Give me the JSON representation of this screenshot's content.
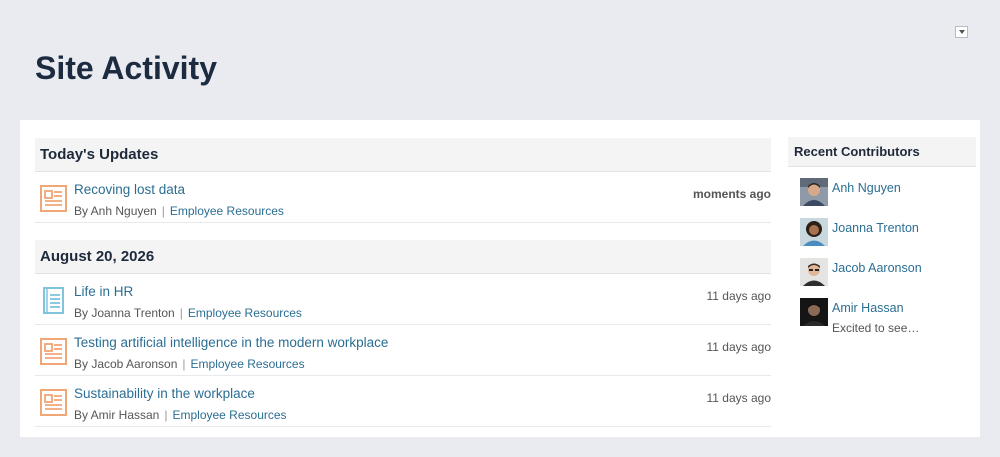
{
  "page": {
    "title": "Site Activity"
  },
  "colors": {
    "link": "#2b6e93",
    "news_icon": "#f0a675",
    "page_icon": "#7fc4dc",
    "background": "#e9ebf0"
  },
  "sections": [
    {
      "header": "Today's Updates",
      "items": [
        {
          "title": "Recoving lost data",
          "by": "By Anh Nguyen",
          "category": "Employee Resources",
          "time": "moments ago",
          "icon": "news-article-icon"
        }
      ]
    },
    {
      "header": "August 20, 2026",
      "items": [
        {
          "title": "Life in HR",
          "by": "By Joanna Trenton",
          "category": "Employee Resources",
          "time": "11 days ago",
          "icon": "page-document-icon"
        },
        {
          "title": "Testing artificial intelligence in the modern workplace",
          "by": "By Jacob Aaronson",
          "category": "Employee Resources",
          "time": "11 days ago",
          "icon": "news-article-icon"
        },
        {
          "title": "Sustainability in the workplace",
          "by": "By Amir Hassan",
          "category": "Employee Resources",
          "time": "11 days ago",
          "icon": "news-article-icon"
        }
      ]
    }
  ],
  "sidebar": {
    "header": "Recent Contributors",
    "contributors": [
      {
        "name": "Anh Nguyen",
        "status": ""
      },
      {
        "name": "Joanna Trenton",
        "status": ""
      },
      {
        "name": "Jacob Aaronson",
        "status": ""
      },
      {
        "name": "Amir Hassan",
        "status": "Excited to see…"
      }
    ]
  }
}
